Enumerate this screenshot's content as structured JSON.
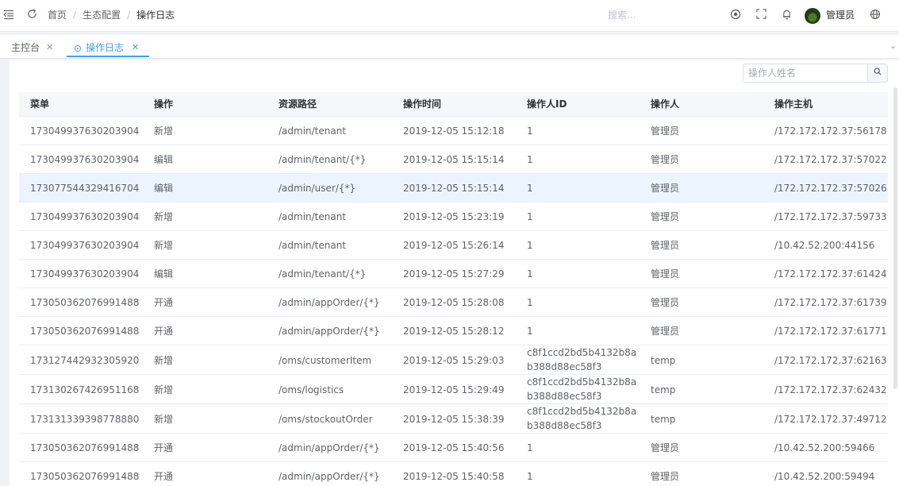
{
  "header": {
    "breadcrumb": [
      "首页",
      "生态配置",
      "操作日志"
    ],
    "search_placeholder": "搜索...",
    "username": "管理员",
    "icons": [
      "menu-fold-icon",
      "refresh-icon",
      "github-icon",
      "fullscreen-icon",
      "bell-icon",
      "globe-icon"
    ]
  },
  "tags": [
    {
      "label": "主控台"
    },
    {
      "label": "操作日志",
      "active": true
    }
  ],
  "filter": {
    "placeholder": "操作人姓名",
    "value": ""
  },
  "table": {
    "columns": [
      "菜单",
      "操作",
      "资源路径",
      "操作时间",
      "操作人ID",
      "操作人",
      "操作主机"
    ],
    "rows": [
      [
        "173049937630203904",
        "新增",
        "/admin/tenant",
        "2019-12-05 15:12:18",
        "1",
        "管理员",
        "/172.172.172.37:56178"
      ],
      [
        "173049937630203904",
        "编辑",
        "/admin/tenant/{*}",
        "2019-12-05 15:15:14",
        "1",
        "管理员",
        "/172.172.172.37:57022"
      ],
      [
        "173077544329416704",
        "编辑",
        "/admin/user/{*}",
        "2019-12-05 15:15:14",
        "1",
        "管理员",
        "/172.172.172.37:57026"
      ],
      [
        "173049937630203904",
        "新增",
        "/admin/tenant",
        "2019-12-05 15:23:19",
        "1",
        "管理员",
        "/172.172.172.37:59733"
      ],
      [
        "173049937630203904",
        "新增",
        "/admin/tenant",
        "2019-12-05 15:26:14",
        "1",
        "管理员",
        "/10.42.52.200:44156"
      ],
      [
        "173049937630203904",
        "编辑",
        "/admin/tenant/{*}",
        "2019-12-05 15:27:29",
        "1",
        "管理员",
        "/172.172.172.37:61424"
      ],
      [
        "173050362076991488",
        "开通",
        "/admin/appOrder/{*}",
        "2019-12-05 15:28:08",
        "1",
        "管理员",
        "/172.172.172.37:61739"
      ],
      [
        "173050362076991488",
        "开通",
        "/admin/appOrder/{*}",
        "2019-12-05 15:28:12",
        "1",
        "管理员",
        "/172.172.172.37:61771"
      ],
      [
        "173127442932305920",
        "新增",
        "/oms/customerItem",
        "2019-12-05 15:29:03",
        "c8f1ccd2bd5b4132b8ab388d88ec58f3",
        "temp",
        "/172.172.172.37:62163"
      ],
      [
        "173130267426951168",
        "新增",
        "/oms/logistics",
        "2019-12-05 15:29:49",
        "c8f1ccd2bd5b4132b8ab388d88ec58f3",
        "temp",
        "/172.172.172.37:62432"
      ],
      [
        "173131339398778880",
        "新增",
        "/oms/stockoutOrder",
        "2019-12-05 15:38:39",
        "c8f1ccd2bd5b4132b8ab388d88ec58f3",
        "temp",
        "/172.172.172.37:49712"
      ],
      [
        "173050362076991488",
        "开通",
        "/admin/appOrder/{*}",
        "2019-12-05 15:40:56",
        "1",
        "管理员",
        "/10.42.52.200:59466"
      ],
      [
        "173050362076991488",
        "开通",
        "/admin/appOrder/{*}",
        "2019-12-05 15:40:58",
        "1",
        "管理员",
        "/10.42.52.200:59494"
      ]
    ],
    "highlighted_row": 2
  },
  "colors": {
    "accent": "#409eff",
    "row_highlight": "#ecf5ff",
    "header_bg": "#f5f7fa"
  }
}
